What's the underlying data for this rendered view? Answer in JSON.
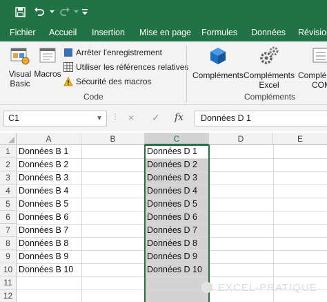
{
  "quick_access": {
    "save_icon": "save-icon",
    "undo_icon": "undo-icon",
    "redo_icon": "redo-icon",
    "customize_icon": "customize-icon"
  },
  "menu": {
    "tabs": [
      "Fichier",
      "Accueil",
      "Insertion",
      "Mise en page",
      "Formules",
      "Données",
      "Révision"
    ]
  },
  "ribbon": {
    "code_group": {
      "visual_basic_line1": "Visual",
      "visual_basic_line2": "Basic",
      "macros": "Macros",
      "record_macro": "Arrêter l'enregistrement",
      "relative_refs": "Utiliser les références relatives",
      "macro_security": "Sécurité des macros",
      "label": "Code"
    },
    "addins_group": {
      "addins": "Compléments",
      "excel_addins_line1": "Compléments",
      "excel_addins_line2": "Excel",
      "com_addins_line1": "Complé",
      "com_addins_line2": "COM",
      "label": "Compléments"
    }
  },
  "formula_bar": {
    "name_box": "C1",
    "cancel_icon": "×",
    "enter_icon": "✓",
    "fx_label": "fx",
    "formula": "Données D 1"
  },
  "sheet": {
    "columns": [
      "A",
      "B",
      "C",
      "D",
      "E"
    ],
    "rows": [
      "1",
      "2",
      "3",
      "4",
      "5",
      "6",
      "7",
      "8",
      "9",
      "10",
      "11",
      "12"
    ],
    "col_a": [
      "Données B 1",
      "Données B 2",
      "Données B 3",
      "Données B 4",
      "Données B 5",
      "Données B 6",
      "Données B 7",
      "Données B 8",
      "Données B 9",
      "Données B 10"
    ],
    "col_c": [
      "Données D 1",
      "Données D 2",
      "Données D 3",
      "Données D 4",
      "Données D 5",
      "Données D 6",
      "Données D 7",
      "Données D 8",
      "Données D 9",
      "Données D 10"
    ],
    "selected_column": "C",
    "accent_color": "#217346"
  },
  "watermark": "EXCEL-PRATIQUE"
}
